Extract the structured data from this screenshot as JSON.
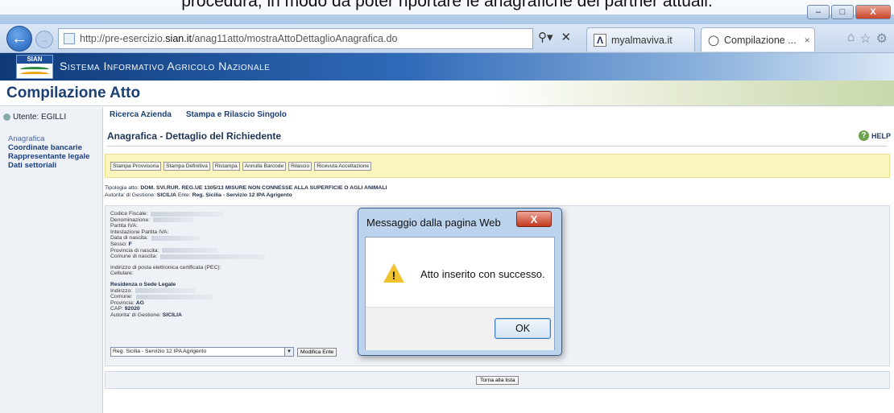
{
  "caption": "procedura, in modo da poter riportare le anagrafiche dei partner attuali.",
  "browser": {
    "url_prefix": "http://pre-esercizio.",
    "url_domain": "sian.it",
    "url_path": "/anag11atto/mostraAttoDettaglioAnagrafica.do",
    "search_icon": "search-icon",
    "tab1_title": "myalmaviva.it",
    "tab2_title": "Compilazione ...",
    "tab_close_symbol": "×",
    "window_controls": [
      "–",
      "□",
      "X"
    ]
  },
  "sian": {
    "logo_text": "SIAN",
    "title": "Sistema Informativo Agricolo Nazionale"
  },
  "page": {
    "title": "Compilazione Atto",
    "user_label": "Utente: EGILLI",
    "side_menu": [
      "Anagrafica",
      "Coordinate bancarie",
      "Rappresentante legale",
      "Dati settoriali"
    ],
    "top_menu": [
      "Ricerca Azienda",
      "Stampa e Rilascio Singolo"
    ],
    "help": "HELP",
    "heading": "Anagrafica - Dettaglio del Richiedente",
    "actions": [
      "Stampa Provvisoria",
      "Stampa Definitiva",
      "Ristampa",
      "Annulla Barcode",
      "Rilascio",
      "Ricevuta Accettazione"
    ],
    "tipologia_label": "Tipologia atto:",
    "tipologia_value": "DOM. SVI.RUR. REG.UE 1305/13 MISURE NON CONNESSE ALLA SUPERFICIE O AGLI ANIMALI",
    "autorita_label": "Autorita' di Gestione:",
    "autorita_value": "SICILIA",
    "ente_label": "Ente:",
    "ente_value": "Reg. Sicilia - Servizio 12 IPA Agrigento",
    "fields": {
      "codice_fiscale": "Codice Fiscale:",
      "denominazione": "Denominazione:",
      "partita_iva": "Partita IVA:",
      "intestazione": "Intestazione Partita IVA:",
      "data_nascita": "Data di nascita:",
      "sesso_label": "Sesso:",
      "sesso_value": "F",
      "provincia_nascita": "Provincia di nascita:",
      "comune_nascita": "Comune di nascita:",
      "pec": "Indirizzo di posta elettronica certificata (PEC):",
      "cellulare": "Cellulare:",
      "residenza_title": "Residenza o Sede Legale",
      "indirizzo": "Indirizzo:",
      "comune": "Comune:",
      "provincia_label": "Provincia:",
      "provincia_value": "AG",
      "cap_label": "CAP:",
      "cap_value": "92020",
      "autorita_label": "Autorita' di Gestione:",
      "autorita_value": "SICILIA"
    },
    "select_value": "Reg. Sicilia - Servizio 12 IPA Agrigento",
    "modifica_button": "Modifica Ente",
    "torna_button": "Torna alla lista"
  },
  "dialog": {
    "title": "Messaggio dalla pagina Web",
    "close_label": "X",
    "message": "Atto inserito con successo.",
    "ok_label": "OK",
    "icon": "warning-icon"
  }
}
